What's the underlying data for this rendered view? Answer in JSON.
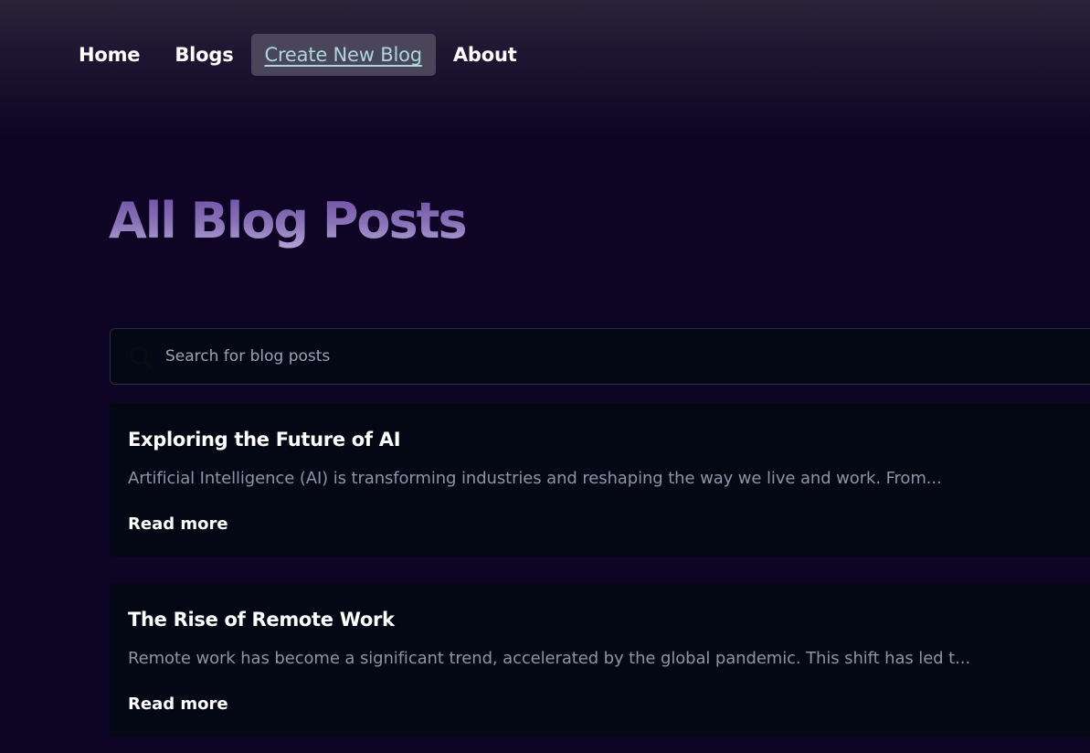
{
  "nav": {
    "items": [
      {
        "label": "Home",
        "active": false
      },
      {
        "label": "Blogs",
        "active": false
      },
      {
        "label": "Create New Blog",
        "active": true
      },
      {
        "label": "About",
        "active": false
      }
    ]
  },
  "main": {
    "title": "All Blog Posts",
    "search": {
      "placeholder": "Search for blog posts",
      "value": "",
      "icon": "search-icon"
    },
    "posts": [
      {
        "title": "Exploring the Future of AI",
        "excerpt": "Artificial Intelligence (AI) is transforming industries and reshaping the way we live and work. From...",
        "read_more": "Read more"
      },
      {
        "title": "The Rise of Remote Work",
        "excerpt": "Remote work has become a significant trend, accelerated by the global pandemic. This shift has led t...",
        "read_more": "Read more"
      }
    ]
  },
  "colors": {
    "background": "#0e0524",
    "card": "#030814",
    "active_nav_bg": "#4a4558",
    "active_nav_text": "#a9d8e3",
    "title_gradient_top": "#6d4ea6",
    "title_gradient_bottom": "#b4a6d6",
    "excerpt_text": "#8b95a8"
  }
}
